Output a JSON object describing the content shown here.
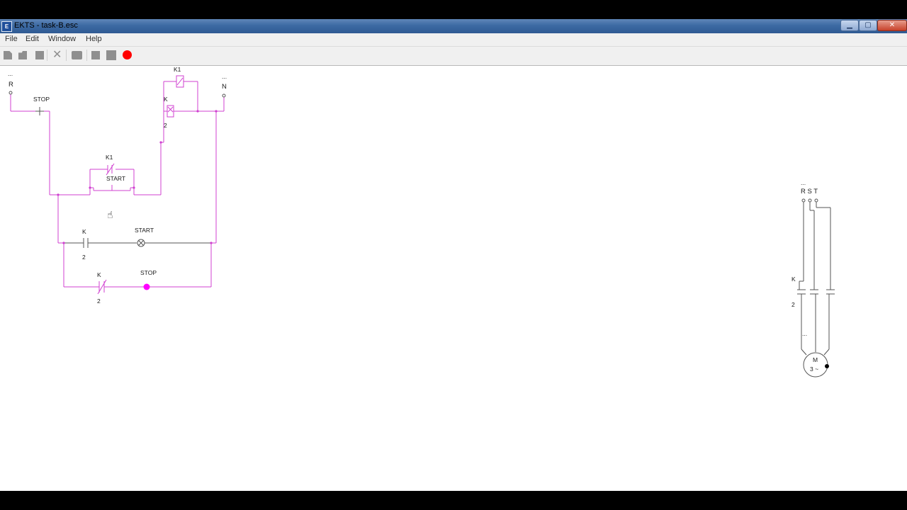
{
  "window": {
    "title": "EKTS - task-B.esc",
    "icon": "ekts-app-icon",
    "controls": {
      "minimize": "▁",
      "maximize": "▢",
      "close": "✕"
    }
  },
  "menu": {
    "file": "File",
    "edit": "Edit",
    "window": "Window",
    "help": "Help"
  },
  "toolbar": {
    "icons": [
      "new-file-icon",
      "open-folder-icon",
      "save-icon",
      "delete-icon",
      "print-icon",
      "step-icon",
      "stop-icon",
      "record-icon"
    ],
    "record_color": "#ff0000"
  },
  "colors": {
    "active_wire": "#d040d0",
    "inactive_wire": "#555555",
    "lamp_on": "#ff00ff"
  },
  "control_circuit": {
    "ellipsis_left": "...",
    "ellipsis_right": "...",
    "phase_label": "R",
    "neutral_label": "N",
    "stop_button_label": "STOP",
    "coil_k1_label": "K1",
    "coil_k_label": "K",
    "coil_k_number": "2",
    "k1_contact_label": "K1",
    "start_button_label": "START",
    "k_contact_1_label": "K",
    "k_contact_1_number": "2",
    "start_lamp_label": "START",
    "k_contact_2_label": "K",
    "k_contact_2_number": "2",
    "stop_lamp_label": "STOP"
  },
  "power_circuit": {
    "ellipsis_top": "...",
    "phases_label": "R S T",
    "contactor_label": "K",
    "contactor_number": "2",
    "ellipsis_mid": "...",
    "motor_label": "M",
    "motor_spec": "3 ~"
  }
}
